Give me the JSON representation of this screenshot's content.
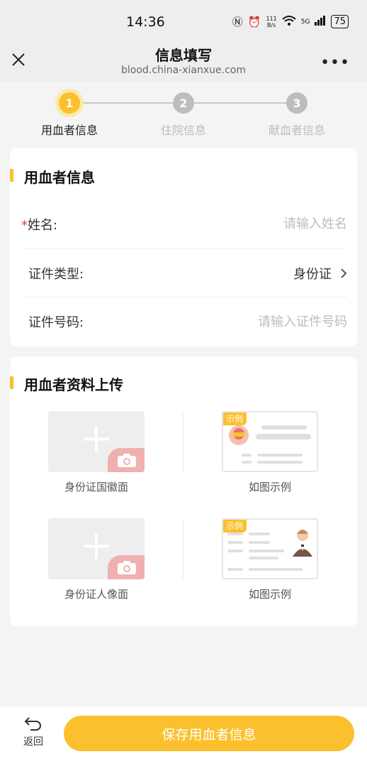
{
  "status_bar": {
    "time": "14:36",
    "net_speed_value": "111",
    "net_speed_unit": "B/s",
    "network": "5G",
    "battery": "75"
  },
  "nav": {
    "title": "信息填写",
    "url": "blood.china-xianxue.com"
  },
  "steps": [
    {
      "number": "1",
      "label": "用血者信息",
      "active": true
    },
    {
      "number": "2",
      "label": "住院信息",
      "active": false
    },
    {
      "number": "3",
      "label": "献血者信息",
      "active": false
    }
  ],
  "info_card": {
    "title": "用血者信息",
    "name": {
      "required_mark": "*",
      "label": "姓名:",
      "placeholder": "请输入姓名",
      "value": ""
    },
    "id_type": {
      "label": "证件类型:",
      "value": "身份证"
    },
    "id_number": {
      "label": "证件号码:",
      "placeholder": "请输入证件号码",
      "value": ""
    }
  },
  "upload_card": {
    "title": "用血者资料上传",
    "rows": [
      {
        "upload_caption": "身份证国徽面",
        "example_tag": "示例",
        "example_caption": "如图示例"
      },
      {
        "upload_caption": "身份证人像面",
        "example_tag": "示例",
        "example_caption": "如图示例"
      }
    ]
  },
  "bottom": {
    "back_label": "返回",
    "save_label": "保存用血者信息"
  },
  "colors": {
    "accent": "#fbc02d",
    "required": "#e53935"
  }
}
